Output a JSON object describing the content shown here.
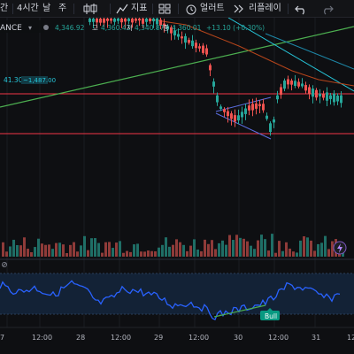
{
  "toolbar": {
    "items": [
      {
        "name": "timeframe-menu-edge",
        "label": "간"
      },
      {
        "name": "timeframe-4h",
        "label": "4시간"
      },
      {
        "name": "timeframe-day",
        "label": "날"
      },
      {
        "name": "timeframe-week",
        "label": "주"
      },
      {
        "name": "indicators-label",
        "label": "지표"
      },
      {
        "name": "alert-label",
        "label": "얼러트"
      },
      {
        "name": "replay-label",
        "label": "리플레이"
      }
    ]
  },
  "symbol": {
    "exchange_fragment": "ANCE",
    "open_label": "",
    "open_value": "4,346.92",
    "high_label": "고",
    "high_value": "4,360.43",
    "low_label": "저",
    "low_value": "4,340.87",
    "close_label": "종",
    "close_value": "4,360.01",
    "change": "+13.10 (+0.30%)"
  },
  "left_price_marker": "41.30",
  "left_price_badge": "~1,487.00",
  "pattern_badge": "Bull",
  "x_axis_labels": [
    "7",
    "12:00",
    "28",
    "12:00",
    "29",
    "12:00",
    "30",
    "12:00",
    "31",
    "12"
  ],
  "colors": {
    "bg": "#0e0f12",
    "up": "#26a69a",
    "down": "#ef5350",
    "trend_green": "#4caf50",
    "trend_cyan": "#26c6da",
    "ma_orange": "#d35400",
    "hline_red": "#f23645",
    "rsi_blue": "#2962ff",
    "rsi_band": "#1a2a3d",
    "wedge_blue": "#5b6ee1",
    "bull": "#089981"
  }
}
